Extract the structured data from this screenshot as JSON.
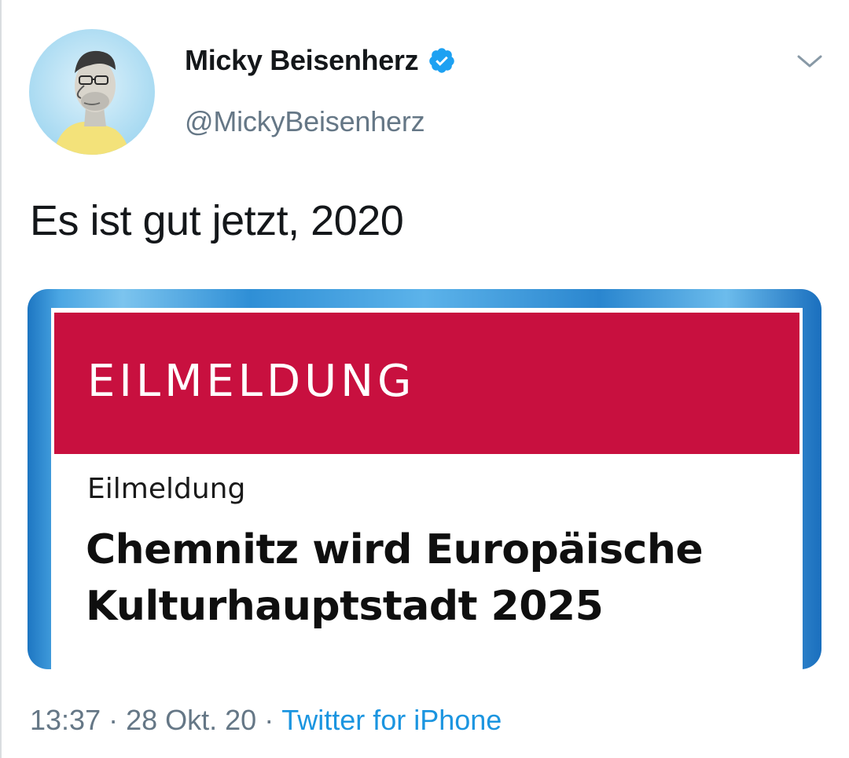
{
  "author": {
    "display_name": "Micky Beisenherz",
    "handle": "@MickyBeisenherz",
    "verified": true
  },
  "tweet": {
    "text": "Es ist gut jetzt, 2020"
  },
  "media": {
    "banner_text": "EILMELDUNG",
    "kicker": "Eilmeldung",
    "headline_line1": "Chemnitz wird Europäische",
    "headline_line2": "Kulturhauptstadt 2025"
  },
  "meta": {
    "time": "13:37",
    "date": "28 Okt. 20",
    "separator": "·",
    "source": "Twitter for iPhone"
  },
  "icons": {
    "verified": "verified-badge-icon",
    "more": "chevron-down-icon"
  },
  "colors": {
    "link": "#1b95e0",
    "secondary_text": "#657786",
    "banner": "#c8103f",
    "verified": "#1da1f2"
  }
}
